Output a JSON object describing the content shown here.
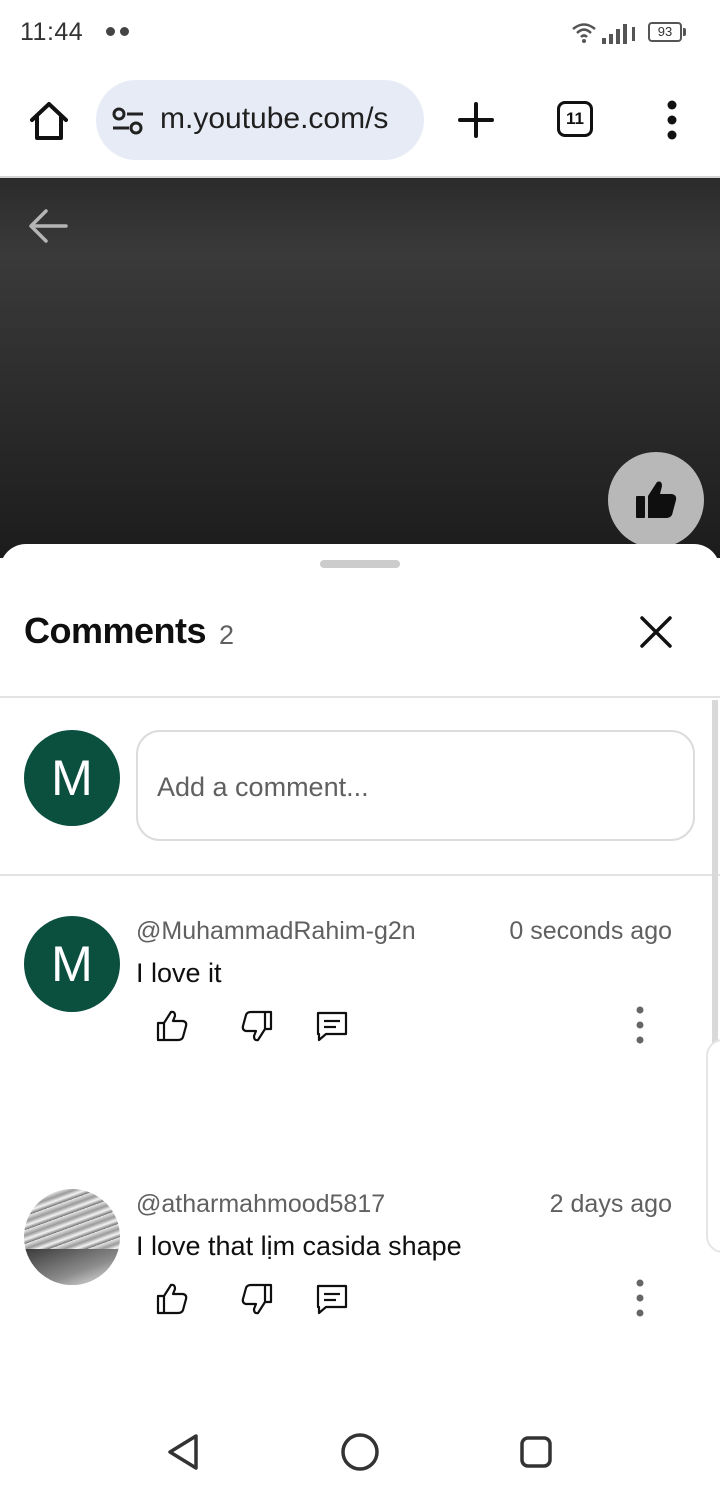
{
  "status_bar": {
    "time": "11:44",
    "battery": "93",
    "icons": [
      "wifi-icon",
      "signal-icon",
      "battery-icon"
    ]
  },
  "browser": {
    "url": "m.youtube.com/s",
    "tab_count": "11",
    "icons": [
      "home-icon",
      "site-settings-icon",
      "new-tab-icon",
      "tabs-icon",
      "more-vert-icon"
    ]
  },
  "video": {
    "icons": [
      "back-arrow-icon",
      "like-icon"
    ]
  },
  "comments_panel": {
    "title": "Comments",
    "count": "2",
    "input_placeholder": "Add a comment...",
    "user_initial": "M",
    "comments": [
      {
        "avatar_initial": "M",
        "handle": "@MuhammadRahim-g2n",
        "time": "0 seconds ago",
        "text": "I love it"
      },
      {
        "avatar_initial": "",
        "handle": "@atharmahmood5817",
        "time": "2 days ago",
        "text": "I love that lịm casida shape"
      }
    ],
    "action_icons": [
      "thumbs-up-icon",
      "thumbs-down-icon",
      "reply-icon",
      "more-vert-icon"
    ]
  },
  "colors": {
    "avatar_green": "#0b4f3f",
    "url_pill": "#e6ebf5",
    "secondary_text": "#606060"
  },
  "nav_bar": {
    "icons": [
      "nav-back-icon",
      "nav-home-icon",
      "nav-recents-icon"
    ]
  }
}
